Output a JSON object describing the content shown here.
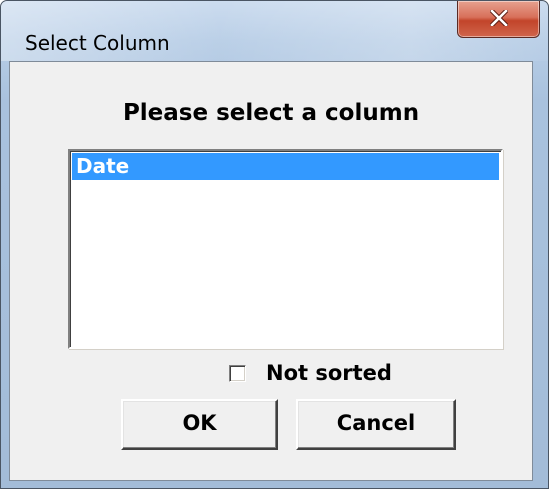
{
  "window": {
    "title": "Select Column"
  },
  "dialog": {
    "prompt": "Please select a column",
    "columns": [
      "Date"
    ],
    "selected_index": 0,
    "not_sorted_label": "Not sorted",
    "not_sorted_checked": false,
    "ok_label": "OK",
    "cancel_label": "Cancel"
  },
  "colors": {
    "selection": "#3399ff",
    "close_button": "#c7472e"
  },
  "icons": {
    "close": "close-icon"
  }
}
